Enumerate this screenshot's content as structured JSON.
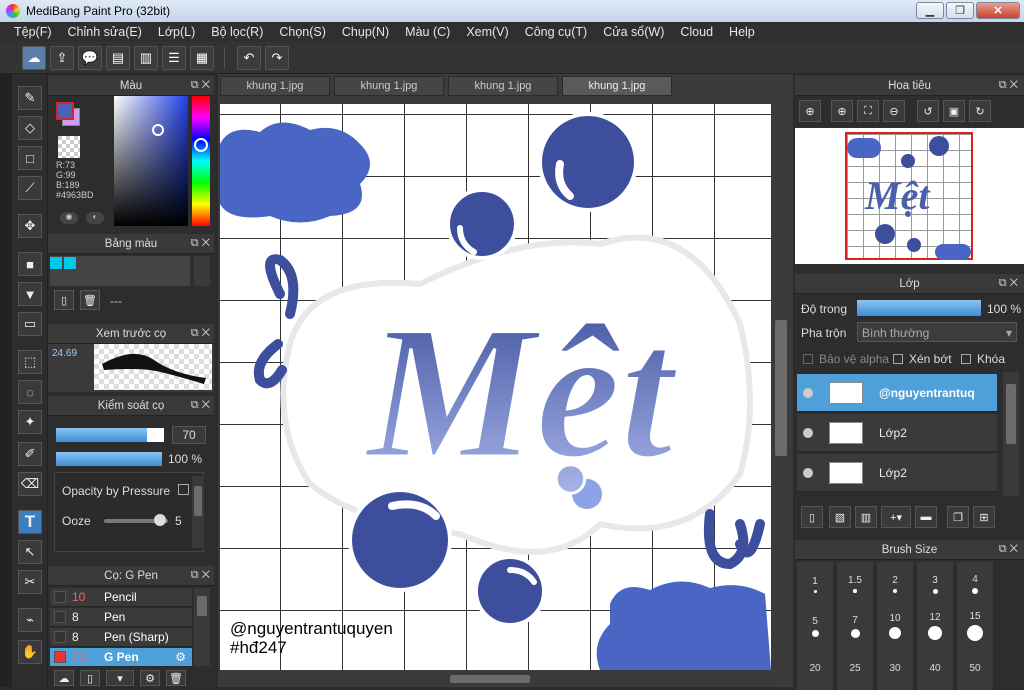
{
  "window": {
    "title": "MediBang Paint Pro (32bit)"
  },
  "menu": [
    "Tệp(F)",
    "Chỉnh sửa(E)",
    "Lớp(L)",
    "Bộ lọc(R)",
    "Chọn(S)",
    "Chụp(N)",
    "Màu (C)",
    "Xem(V)",
    "Công cụ(T)",
    "Cửa sổ(W)",
    "Cloud",
    "Help"
  ],
  "toolbar": {
    "undo_glyph": "↶",
    "redo_glyph": "↷"
  },
  "color_panel": {
    "title": "Màu",
    "r": "R:73",
    "g": "G:99",
    "b": "B:189",
    "hex": "#4963BD",
    "primary_color": "#4963BD",
    "secondary_color": "#c8a0f0"
  },
  "palette_panel": {
    "title": "Bảng màu",
    "swatch_color": "#00c8e6",
    "value": "---"
  },
  "brush_preview_panel": {
    "title": "Xem trước cọ",
    "size": "24.69"
  },
  "brush_control_panel": {
    "title": "Kiểm soát cọ",
    "size_value": "70",
    "opacity_value": "100 %",
    "size_fraction": 0.84,
    "opacity_fraction": 1.0,
    "opacity_by_pressure_label": "Opacity by Pressure",
    "ooze_label": "Ooze",
    "ooze_value": "5"
  },
  "brush_list_panel": {
    "title": "Cọ: G Pen",
    "items": [
      {
        "size": "10",
        "name": "Pencil",
        "color": "#333",
        "size_color": "#e66"
      },
      {
        "size": "8",
        "name": "Pen",
        "color": "#333",
        "size_color": "#eee"
      },
      {
        "size": "8",
        "name": "Pen (Sharp)",
        "color": "#333",
        "size_color": "#eee"
      },
      {
        "size": "70",
        "name": "G Pen",
        "color": "#e33",
        "size_color": "#e66",
        "selected": true
      }
    ]
  },
  "tabs": [
    "khung 1.jpg",
    "khung 1.jpg",
    "khung 1.jpg",
    "khung 1.jpg"
  ],
  "artwork": {
    "main_text": "Mệt",
    "signature_line1": "@nguyentrantuquyen",
    "signature_line2": "#hđ247",
    "blue": "#3d4f9c",
    "grid_color": "#333333"
  },
  "navigator_panel": {
    "title": "Hoa tiêu"
  },
  "layers_panel": {
    "title": "Lớp",
    "opacity_label": "Độ trong",
    "opacity_value": "100 %",
    "opacity_fraction": 1.0,
    "blend_label": "Pha trộn",
    "blend_value": "Bình thường",
    "protect_alpha": "Bảo vệ alpha",
    "clipping": "Xén bớt",
    "lock": "Khóa",
    "layers": [
      {
        "name": "@nguyentrantuq",
        "selected": true
      },
      {
        "name": "Lớp2",
        "selected": false
      },
      {
        "name": "Lớp2",
        "selected": false
      }
    ]
  },
  "brush_size_panel": {
    "title": "Brush Size",
    "row1": [
      "1",
      "1.5",
      "2",
      "3",
      "4"
    ],
    "row2": [
      "5",
      "7",
      "10",
      "12",
      "15"
    ],
    "row3": [
      "20",
      "25",
      "30",
      "40",
      "50"
    ]
  }
}
